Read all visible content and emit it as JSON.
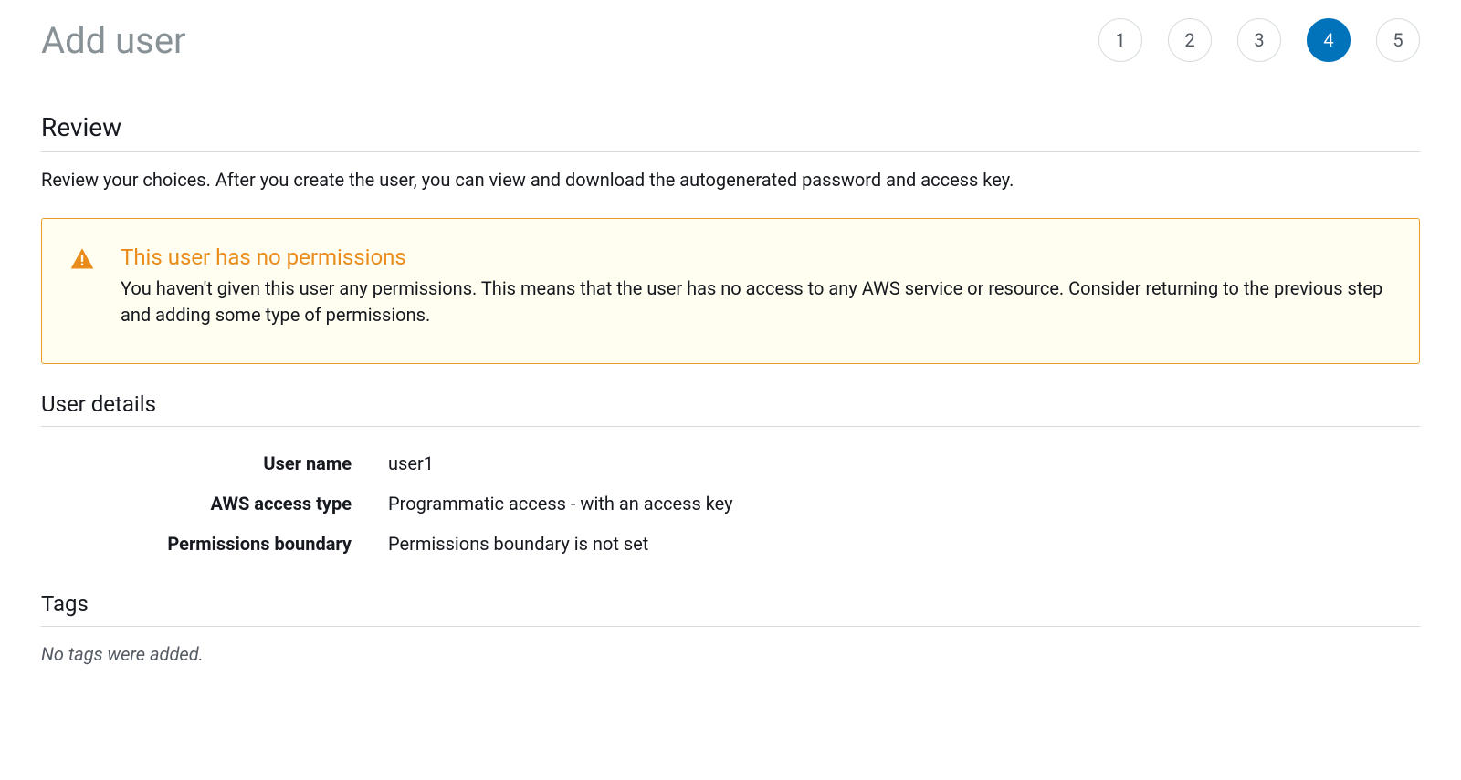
{
  "header": {
    "title": "Add user",
    "steps": [
      {
        "label": "1",
        "active": false
      },
      {
        "label": "2",
        "active": false
      },
      {
        "label": "3",
        "active": false
      },
      {
        "label": "4",
        "active": true
      },
      {
        "label": "5",
        "active": false
      }
    ]
  },
  "review": {
    "heading": "Review",
    "description": "Review your choices. After you create the user, you can view and download the autogenerated password and access key."
  },
  "alert": {
    "title": "This user has no permissions",
    "description": "You haven't given this user any permissions. This means that the user has no access to any AWS service or resource. Consider returning to the previous step and adding some type of permissions."
  },
  "user_details": {
    "heading": "User details",
    "rows": [
      {
        "label": "User name",
        "value": "user1"
      },
      {
        "label": "AWS access type",
        "value": "Programmatic access - with an access key"
      },
      {
        "label": "Permissions boundary",
        "value": "Permissions boundary is not set"
      }
    ]
  },
  "tags": {
    "heading": "Tags",
    "empty_text": "No tags were added."
  }
}
